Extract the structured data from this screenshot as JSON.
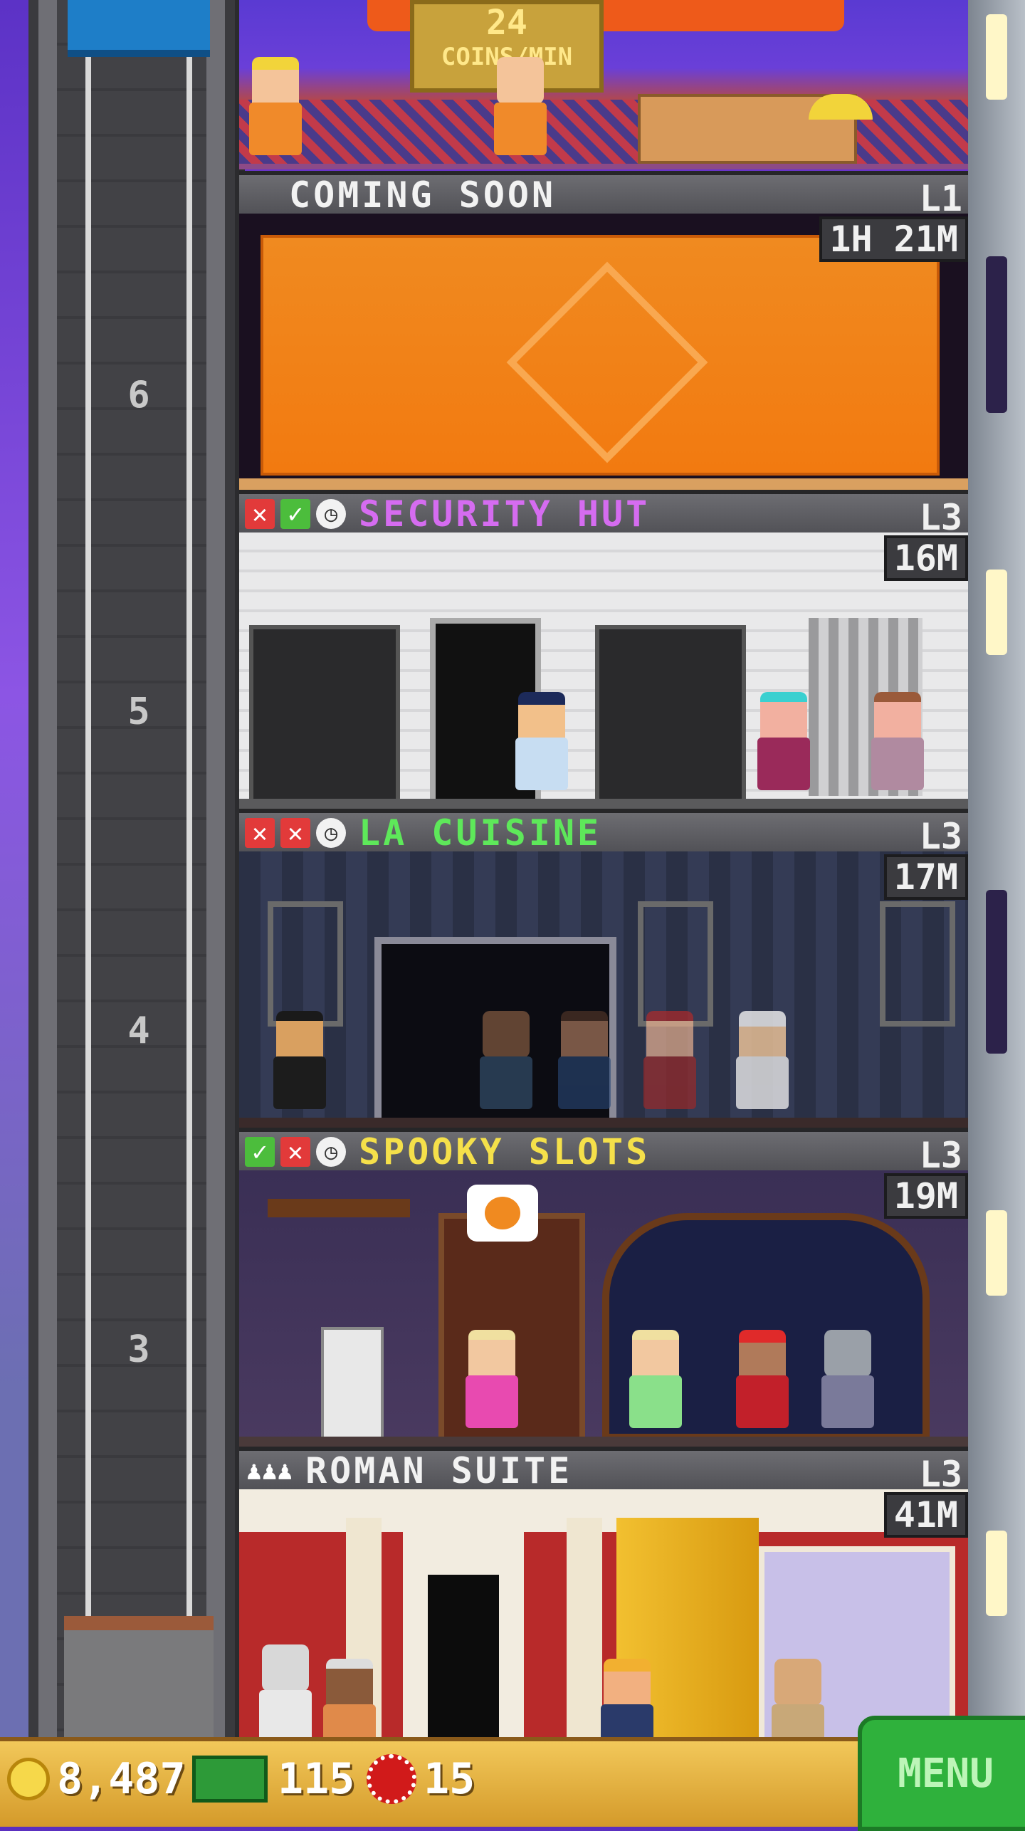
{
  "top_floor": {
    "income_badge_value": "24",
    "income_badge_unit": "COINS/MIN"
  },
  "elevator": {
    "floor_markers": [
      "6",
      "5",
      "4",
      "3"
    ]
  },
  "floors": [
    {
      "title": "COMING SOON",
      "title_color": "#f2f2f2",
      "level": "L1",
      "timer": "1H 21M",
      "status_icons": []
    },
    {
      "title": "SECURITY HUT",
      "title_color": "#d56cf0",
      "level": "L3",
      "timer": "16M",
      "status_icons": [
        "x-icon",
        "check-icon",
        "clock-icon"
      ]
    },
    {
      "title": "LA CUISINE",
      "title_color": "#5ee85a",
      "level": "L3",
      "timer": "17M",
      "status_icons": [
        "x-icon",
        "x-icon",
        "clock-icon"
      ]
    },
    {
      "title": "SPOOKY SLOTS",
      "title_color": "#f5e04a",
      "level": "L3",
      "timer": "19M",
      "status_icons": [
        "check-icon",
        "x-icon",
        "clock-icon"
      ]
    },
    {
      "title": "ROMAN SUITE",
      "title_color": "#f2f2f2",
      "level": "L3",
      "timer": "41M",
      "status_icons": [
        "worker-icon",
        "worker-icon",
        "worker-icon"
      ]
    }
  ],
  "hud": {
    "coins": "8,487",
    "bux": "115",
    "tokens": "15",
    "menu_label": "MENU"
  },
  "colors": {
    "no": "#e23a3a",
    "yes": "#4cbd3c",
    "menu": "#2fb13c",
    "hud": "#e2b040"
  }
}
